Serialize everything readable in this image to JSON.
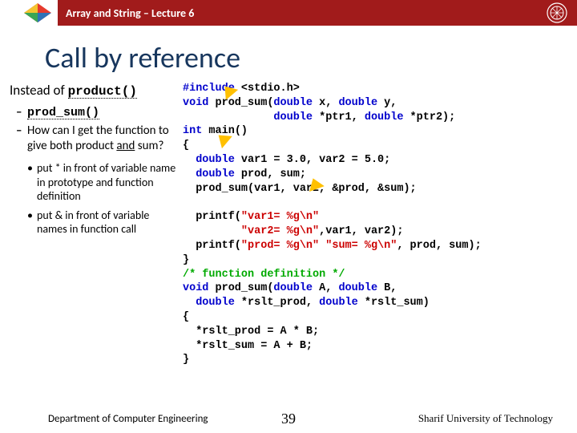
{
  "header": {
    "title": "Array and String – Lecture 6"
  },
  "title": "Call by reference",
  "left": {
    "instead_prefix": "Instead of ",
    "instead_code": "product()",
    "d1_code": "prod_sum()",
    "d2_a": "How can I get the function to give both product ",
    "d2_b": "and",
    "d2_c": " sum?",
    "b1": "put * in front of variable name in prototype and function definition",
    "b2": "put & in front of variable names in function call"
  },
  "code": {
    "l1a": "#include ",
    "l1b": "<stdio.h>",
    "l2a": "void",
    "l2b": " prod_sum(",
    "l2c": "double",
    "l2d": " x, ",
    "l2e": "double",
    "l2f": " y,",
    "l3a": "              ",
    "l3b": "double",
    "l3c": " *ptr1, ",
    "l3d": "double",
    "l3e": " *ptr2);",
    "l4a": "int",
    "l4b": " main()",
    "l5": "{",
    "l6a": "  ",
    "l6b": "double",
    "l6c": " var1 = 3.0, var2 = 5.0;",
    "l7a": "  ",
    "l7b": "double",
    "l7c": " prod, sum;",
    "l8": "  prod_sum(var1, var2, &prod, &sum);",
    "blank1": " ",
    "l9a": "  printf(",
    "l9b": "\"var1= %g\\n\"",
    "l10a": "         ",
    "l10b": "\"var2= %g\\n\"",
    "l10c": ",var1, var2);",
    "l11a": "  printf(",
    "l11b": "\"prod= %g\\n\" \"sum= %g\\n\"",
    "l11c": ", prod, sum);",
    "l12": "}",
    "l13": "/* function definition */",
    "l14a": "void",
    "l14b": " prod_sum(",
    "l14c": "double",
    "l14d": " A, ",
    "l14e": "double",
    "l14f": " B,",
    "l15a": "  ",
    "l15b": "double",
    "l15c": " *rslt_prod, ",
    "l15d": "double",
    "l15e": " *rslt_sum)",
    "l16": "{",
    "l17": "  *rslt_prod = A * B;",
    "l18": "  *rslt_sum = A + B;",
    "l19": "}"
  },
  "footer": {
    "left": "Department of Computer Engineering",
    "page": "39",
    "right": "Sharif University of Technology"
  }
}
